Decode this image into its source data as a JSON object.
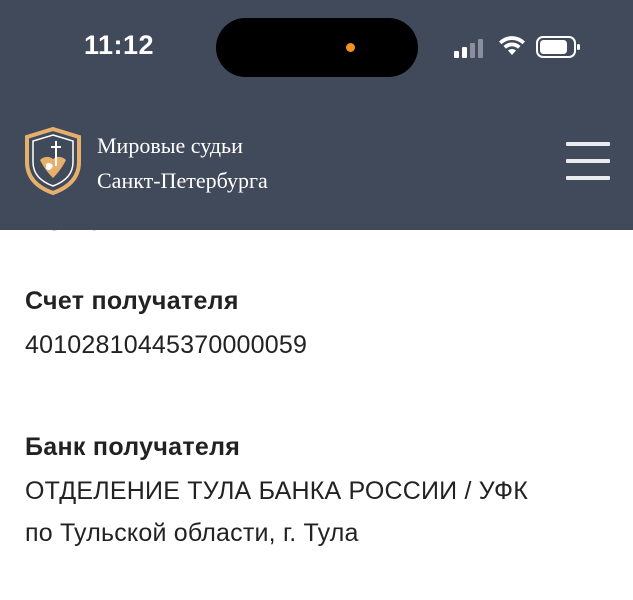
{
  "status_bar": {
    "time": "11:12",
    "icons": [
      "signal-icon",
      "wifi-icon",
      "battery-icon"
    ],
    "privacy_dot_color": "#f5921e"
  },
  "header": {
    "background_color": "#414a5a",
    "logo_icon": "shield-emblem-icon",
    "title_line1": "Мировые судьи",
    "title_line2": "Санкт-Петербурга",
    "menu_icon": "hamburger-menu-icon"
  },
  "content": {
    "partial_heading": "ПОШЛИНЫ",
    "account": {
      "label": "Счет получателя",
      "value": "40102810445370000059"
    },
    "bank": {
      "label": "Банк получателя",
      "value_line1": "ОТДЕЛЕНИЕ ТУЛА БАНКА РОССИИ / УФК",
      "value_line2": "по Тульской области, г. Тула"
    }
  }
}
